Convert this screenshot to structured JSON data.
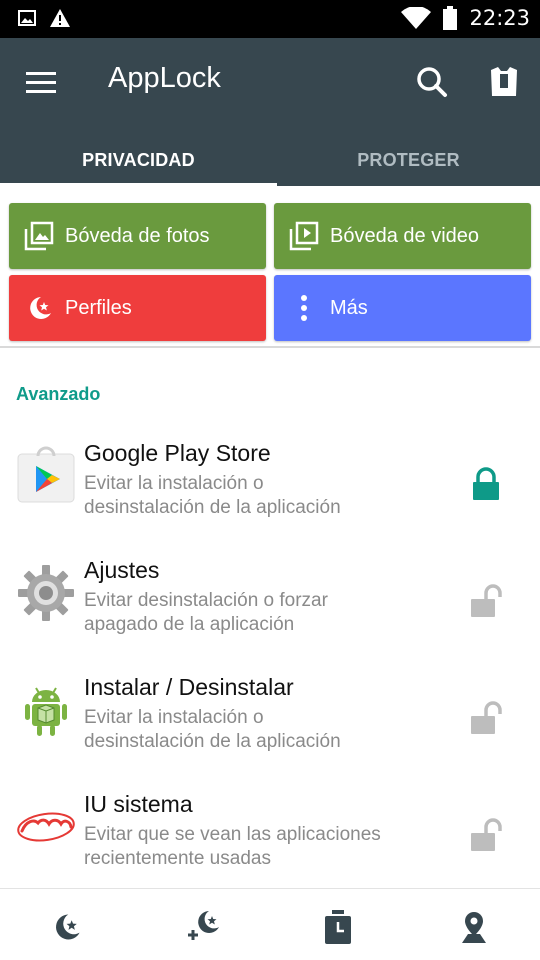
{
  "status_bar": {
    "time": "22:23",
    "icons": [
      "image-notification-icon",
      "warning-icon",
      "wifi-icon",
      "battery-icon"
    ]
  },
  "app_bar": {
    "title": "AppLock",
    "color": "#37474f",
    "icons": [
      "menu-icon",
      "search-icon",
      "theme-icon"
    ]
  },
  "tabs": [
    {
      "label": "PRIVACIDAD",
      "active": true
    },
    {
      "label": "PROTEGER",
      "active": false
    }
  ],
  "tiles": {
    "photo_vault": {
      "label": "Bóveda de fotos",
      "color": "#6a9a3e",
      "icon": "photo-gallery-icon"
    },
    "video_vault": {
      "label": "Bóveda de video",
      "color": "#6a9a3e",
      "icon": "video-library-icon"
    },
    "profiles": {
      "label": "Perfiles",
      "color": "#ef3d3d",
      "icon": "moon-star-icon"
    },
    "more": {
      "label": "Más",
      "color": "#5b76ff",
      "icon": "more-vertical-icon"
    }
  },
  "section": {
    "title": "Avanzado",
    "color": "#109b8a"
  },
  "items": [
    {
      "title": "Google Play Store",
      "desc_line1": "Evitar la instalación o",
      "desc_line2": "desinstalación de la aplicación",
      "icon": "google-play-store-icon",
      "locked": true
    },
    {
      "title": "Ajustes",
      "desc_line1": "Evitar desinstalación o forzar",
      "desc_line2": "apagado de la aplicación",
      "icon": "settings-gear-icon",
      "locked": false
    },
    {
      "title": "Instalar / Desinstalar",
      "desc_line1": "Evitar la instalación o",
      "desc_line2": "desinstalación de la aplicación",
      "icon": "android-package-icon",
      "locked": false
    },
    {
      "title": "IU sistema",
      "desc_line1": "Evitar que se vean las aplicaciones",
      "desc_line2": "recientemente usadas",
      "icon": "android-logo-icon",
      "locked": false
    }
  ],
  "colors": {
    "locked": "#0e9a88",
    "unlocked": "#bdbdbd"
  },
  "bottom_nav": [
    "moon-star-icon",
    "add-profile-icon",
    "timer-icon",
    "location-pin-icon"
  ]
}
